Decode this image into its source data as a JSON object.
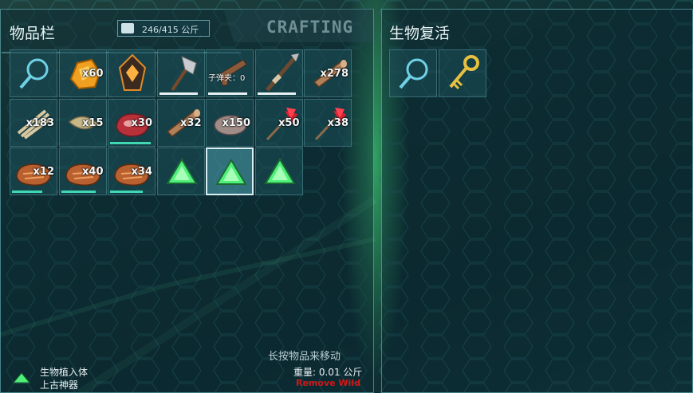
{
  "inventory": {
    "title": "物品栏",
    "weight": "246/415 公斤",
    "crafting_tab": "CRAFTING",
    "hint": "长按物品来移动",
    "slots": [
      {
        "icon": "magnifier-icon",
        "qty": ""
      },
      {
        "icon": "amber-icon",
        "qty": "x60"
      },
      {
        "icon": "specimen-implant-icon",
        "qty": ""
      },
      {
        "icon": "hatchet-icon",
        "qty": "",
        "durability": 0.9
      },
      {
        "icon": "pistol-icon",
        "qty": "",
        "ammo": "子弹夹：0",
        "durability": 0.9
      },
      {
        "icon": "spear-icon",
        "qty": "",
        "durability": 0.9
      },
      {
        "icon": "wood-icon",
        "qty": "x278"
      },
      {
        "icon": "thatch-icon",
        "qty": "x183"
      },
      {
        "icon": "fiber-icon",
        "qty": "x15"
      },
      {
        "icon": "raw-meat-icon",
        "qty": "x30",
        "spoil": 0.95
      },
      {
        "icon": "wood-icon",
        "qty": "x32"
      },
      {
        "icon": "stone-icon",
        "qty": "x150"
      },
      {
        "icon": "arrow-icon",
        "qty": "x50"
      },
      {
        "icon": "arrow-icon",
        "qty": "x38"
      },
      {
        "icon": "cooked-meat-icon",
        "qty": "x12",
        "spoil": 0.7
      },
      {
        "icon": "cooked-meat-icon",
        "qty": "x40",
        "spoil": 0.8
      },
      {
        "icon": "cooked-meat-icon",
        "qty": "x34",
        "spoil": 0.75
      },
      {
        "icon": "artifact-icon",
        "qty": ""
      },
      {
        "icon": "artifact-icon",
        "qty": "",
        "selected": true
      },
      {
        "icon": "artifact-icon",
        "qty": ""
      }
    ]
  },
  "revival": {
    "title": "生物复活",
    "slots": [
      {
        "icon": "magnifier-icon"
      },
      {
        "icon": "key-icon"
      }
    ]
  },
  "selected_item": {
    "name_line1": "生物植入体",
    "name_line2": "上古神器",
    "weight": "重量: 0.01 公斤",
    "remove": "Remove Wild"
  },
  "colors": {
    "accent": "#3fd8b3",
    "remove": "#d01818",
    "artifact": "#4ff07a"
  }
}
